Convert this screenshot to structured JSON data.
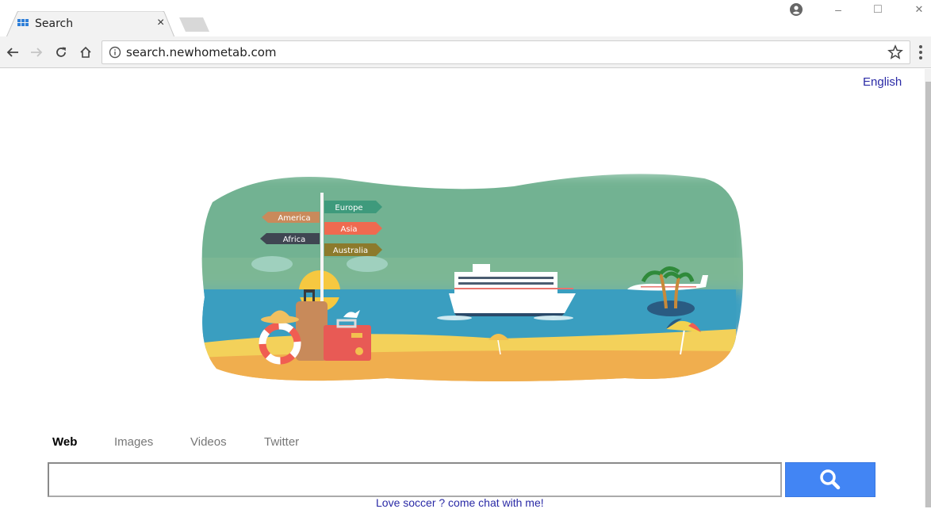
{
  "browser": {
    "tab": {
      "title": "Search",
      "favicon": "grid-favicon-icon",
      "close": "×"
    },
    "new_tab": "new-tab-icon",
    "window_controls": {
      "profile": "profile-icon",
      "minimize": "–",
      "maximize": "□",
      "close": "✕"
    },
    "toolbar": {
      "back": "back-arrow-icon",
      "forward": "forward-arrow-icon",
      "reload": "reload-icon",
      "home": "home-icon",
      "address": "search.newhometab.com",
      "site_info": "info-icon",
      "bookmark": "star-icon",
      "menu": "kebab-menu-icon"
    }
  },
  "page": {
    "language_link": "English",
    "hero": {
      "signs_left": [
        "America",
        "Africa"
      ],
      "signs_right": [
        "Europe",
        "Asia",
        "Australia"
      ],
      "colors": {
        "sky": "#6fae8f",
        "sea": "#3a9ec0",
        "sand": "#f3d15a",
        "sand_dark": "#eaa24d",
        "sign_europe": "#3e9a7c",
        "sign_america": "#c98a5b",
        "sign_asia": "#ef6a50",
        "sign_africa": "#3f4652",
        "sign_australia": "#8c7a2c"
      }
    },
    "search_tabs": [
      {
        "label": "Web",
        "active": true
      },
      {
        "label": "Images",
        "active": false
      },
      {
        "label": "Videos",
        "active": false
      },
      {
        "label": "Twitter",
        "active": false
      }
    ],
    "search": {
      "value": "",
      "placeholder": "",
      "button_icon": "magnifier-icon",
      "button_color": "#4285f4"
    },
    "promo_link": "Love soccer ? come chat with me!"
  }
}
